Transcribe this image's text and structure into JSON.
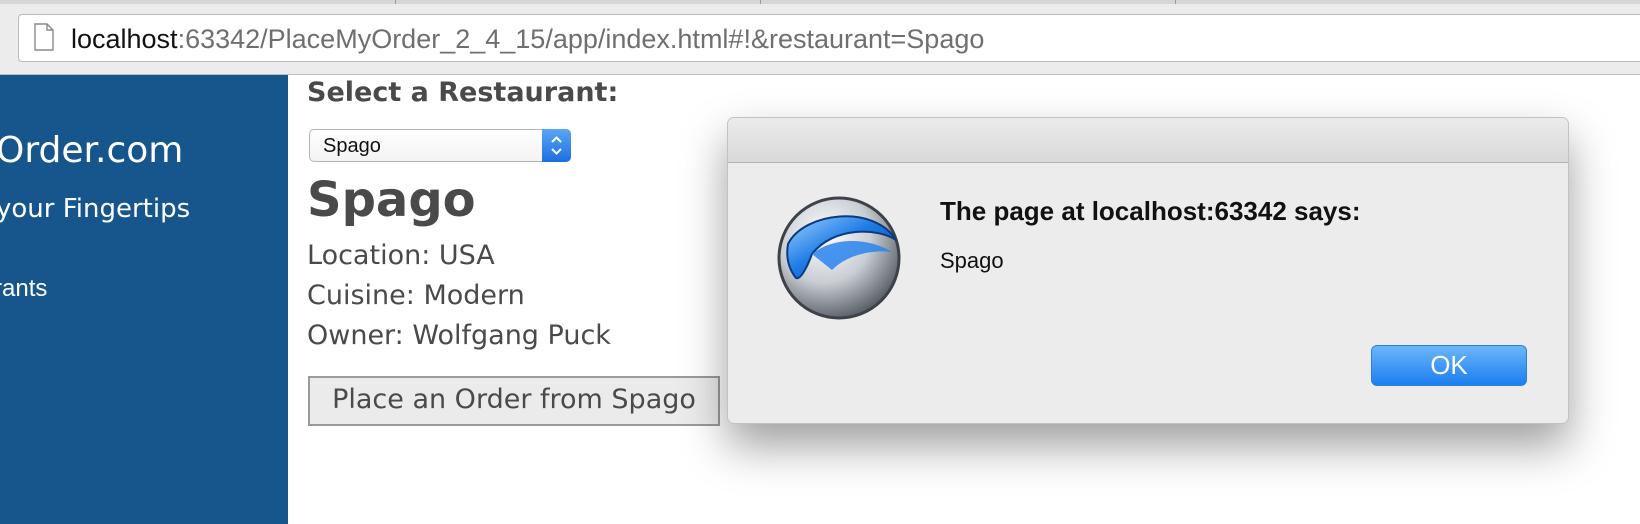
{
  "browser": {
    "url_host": "localhost",
    "url_rest": ":63342/PlaceMyOrder_2_4_15/app/index.html#!&restaurant=Spago",
    "page_icon": "page-icon"
  },
  "sidebar": {
    "brand": "Order.com",
    "tagline": "your Fingertips",
    "nav_link": "rants"
  },
  "main": {
    "select_label": "Select a Restaurant:",
    "select_value": "Spago",
    "restaurant_name": "Spago",
    "location": "Location: USA",
    "cuisine": "Cuisine: Modern",
    "owner": "Owner: Wolfgang Puck",
    "order_button": "Place an Order from Spago"
  },
  "dialog": {
    "title": "The page at localhost:63342 says:",
    "message": "Spago",
    "ok_label": "OK",
    "logo_icon": "srware-iron-logo-icon"
  },
  "colors": {
    "sidebar_bg": "#17568c",
    "text_gray": "#4a4a4a",
    "accent_blue": "#1a7ef0"
  }
}
